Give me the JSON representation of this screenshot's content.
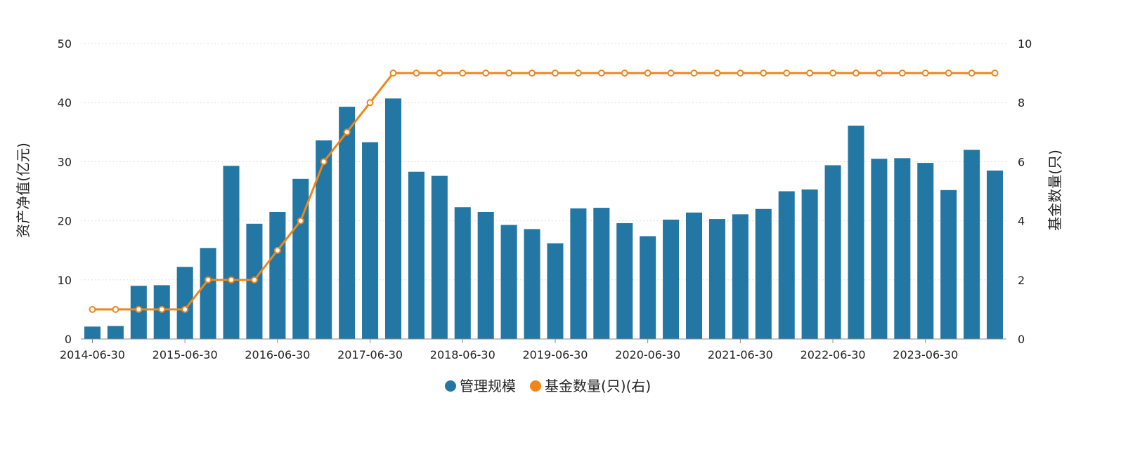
{
  "chart_data": {
    "type": "bar",
    "categories": [
      "2014-06-30",
      "2014-09-30",
      "2014-12-31",
      "2015-03-31",
      "2015-06-30",
      "2015-09-30",
      "2015-12-31",
      "2016-03-31",
      "2016-06-30",
      "2016-09-30",
      "2016-12-31",
      "2017-03-31",
      "2017-06-30",
      "2017-09-30",
      "2017-12-31",
      "2018-03-31",
      "2018-06-30",
      "2018-09-30",
      "2018-12-31",
      "2019-03-31",
      "2019-06-30",
      "2019-09-30",
      "2019-12-31",
      "2020-03-31",
      "2020-06-30",
      "2020-09-30",
      "2020-12-31",
      "2021-03-31",
      "2021-06-30",
      "2021-09-30",
      "2021-12-31",
      "2022-03-31",
      "2022-06-30",
      "2022-09-30",
      "2022-12-31",
      "2023-03-31",
      "2023-06-30",
      "2023-09-30",
      "2023-12-31",
      "2024-03-31"
    ],
    "x_tick_labels": [
      "2014-06-30",
      "2015-06-30",
      "2016-06-30",
      "2017-06-30",
      "2018-06-30",
      "2019-06-30",
      "2020-06-30",
      "2021-06-30",
      "2022-06-30",
      "2023-06-30"
    ],
    "series": [
      {
        "name": "管理规模",
        "type": "bar",
        "axis": "left",
        "color": "#2377a4",
        "values": [
          2.1,
          2.2,
          9.0,
          9.1,
          12.2,
          15.4,
          29.3,
          19.5,
          21.5,
          27.1,
          33.6,
          39.3,
          33.3,
          40.7,
          28.3,
          27.6,
          22.3,
          21.5,
          19.3,
          18.6,
          16.2,
          22.1,
          22.2,
          19.6,
          17.4,
          20.2,
          21.4,
          20.3,
          21.1,
          22.0,
          25.0,
          25.3,
          29.4,
          36.1,
          30.5,
          30.6,
          29.8,
          25.2,
          32.0,
          28.5
        ]
      },
      {
        "name": "基金数量(只)(右)",
        "type": "line",
        "axis": "right",
        "color": "#f08519",
        "values": [
          1,
          1,
          1,
          1,
          1,
          2,
          2,
          2,
          3,
          4,
          6,
          7,
          8,
          9,
          9,
          9,
          9,
          9,
          9,
          9,
          9,
          9,
          9,
          9,
          9,
          9,
          9,
          9,
          9,
          9,
          9,
          9,
          9,
          9,
          9,
          9,
          9,
          9,
          9,
          9
        ]
      }
    ],
    "y_left": {
      "label": "资产净值(亿元)",
      "min": 0,
      "max": 50,
      "ticks": [
        "0",
        "10",
        "20",
        "30",
        "40",
        "50"
      ]
    },
    "y_right": {
      "label": "基金数量(只)",
      "min": 0,
      "max": 10,
      "ticks": [
        "0",
        "2",
        "4",
        "6",
        "8",
        "10"
      ]
    },
    "grid": true,
    "legend_position": "bottom-center"
  }
}
